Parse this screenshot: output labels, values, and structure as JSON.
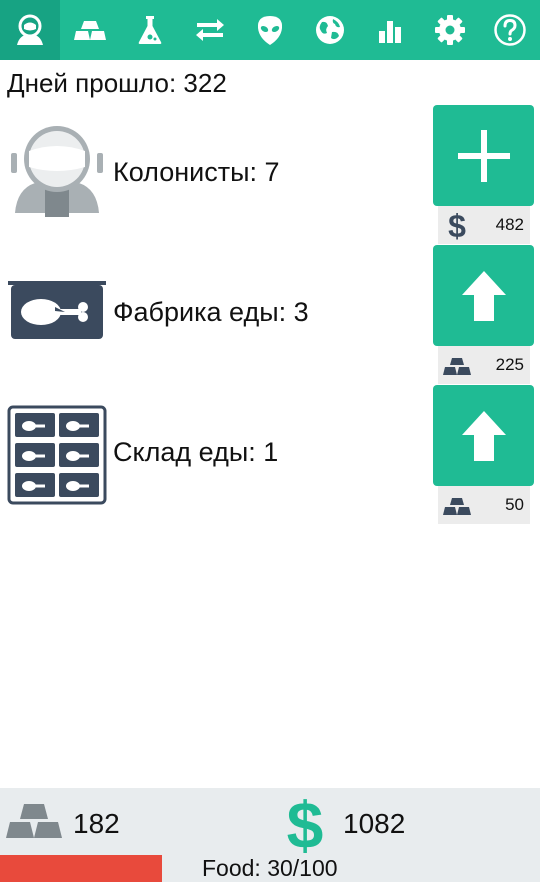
{
  "tabs": [
    {
      "name": "tab-colonists",
      "icon": "astronaut-icon",
      "active": true
    },
    {
      "name": "tab-resources",
      "icon": "metal-bars-icon",
      "active": false
    },
    {
      "name": "tab-research",
      "icon": "flask-icon",
      "active": false
    },
    {
      "name": "tab-trade",
      "icon": "exchange-icon",
      "active": false
    },
    {
      "name": "tab-aliens",
      "icon": "alien-icon",
      "active": false
    },
    {
      "name": "tab-planet",
      "icon": "globe-icon",
      "active": false
    },
    {
      "name": "tab-stats",
      "icon": "bar-chart-icon",
      "active": false
    },
    {
      "name": "tab-settings",
      "icon": "gear-icon",
      "active": false
    },
    {
      "name": "tab-help",
      "icon": "help-icon",
      "active": false
    }
  ],
  "days_label": "Дней прошло: 322",
  "items": [
    {
      "label": "Колонисты: 7",
      "action": "add",
      "cost": "482",
      "cost_icon": "dollar-icon"
    },
    {
      "label": "Фабрика еды: 3",
      "action": "upgrade",
      "cost": "225",
      "cost_icon": "metal-bars-icon"
    },
    {
      "label": "Склад еды: 1",
      "action": "upgrade",
      "cost": "50",
      "cost_icon": "metal-bars-icon"
    }
  ],
  "status": {
    "metal": "182",
    "money": "1082",
    "food_label": "Food: 30/100",
    "food_fraction": 0.3
  },
  "colors": {
    "accent": "#1fbb94",
    "accent_dark": "#17a383",
    "money": "#1fbb94",
    "food_bar": "#e84a3c",
    "icon_dark": "#3b4a5e"
  }
}
